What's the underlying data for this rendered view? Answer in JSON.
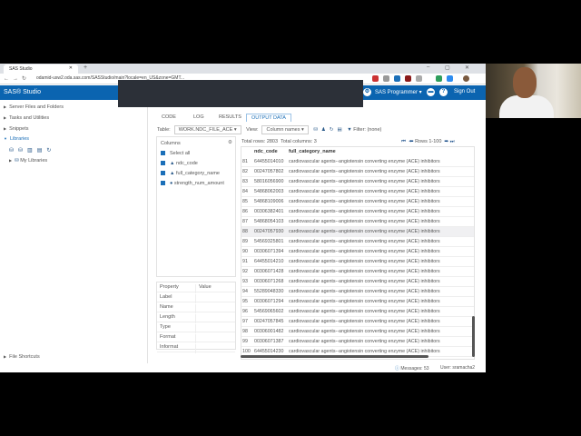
{
  "browser": {
    "tab_title": "SAS Studio",
    "url": "odamid-usw2.oda.sas.com/SASStudio/main?locale=en_US&zone=GMT..."
  },
  "header": {
    "app_name": "SAS® Studio",
    "menu": "SAS Programmer ▾",
    "sign_out": "Sign Out"
  },
  "sidebar": {
    "items": [
      "Server Files and Folders",
      "Tasks and Utilities",
      "Snippets",
      "Libraries"
    ],
    "my_libraries": "My Libraries",
    "file_shortcuts": "File Shortcuts"
  },
  "tabs": [
    "CODE",
    "LOG",
    "RESULTS",
    "OUTPUT DATA"
  ],
  "toolbar": {
    "table_label": "Table:",
    "table_value": "WORK.NDC_FILE_ACE",
    "view_label": "View:",
    "view_value": "Column names",
    "filter_label": "Filter:",
    "filter_value": "(none)"
  },
  "columns": {
    "title": "Columns",
    "select_all": "Select all",
    "items": [
      "ndc_code",
      "full_category_name",
      "strength_num_amount"
    ]
  },
  "properties": {
    "header": [
      "Property",
      "Value"
    ],
    "rows": [
      "Label",
      "Name",
      "Length",
      "Type",
      "Format",
      "Informat"
    ]
  },
  "grid": {
    "total_rows": "Total rows: 2803",
    "total_columns": "Total columns: 3",
    "pager": "Rows 1-100",
    "headers": [
      "ndc_code",
      "full_category_name"
    ],
    "category": "cardiovascular agents--angiotensin converting enzyme (ACE) inhibitors",
    "rows": [
      [
        "81",
        "64455014010"
      ],
      [
        "82",
        "00247057802"
      ],
      [
        "83",
        "58016056900"
      ],
      [
        "84",
        "54868062003"
      ],
      [
        "85",
        "54868109006"
      ],
      [
        "86",
        "00306382401"
      ],
      [
        "87",
        "54868054103"
      ],
      [
        "88",
        "00247057930"
      ],
      [
        "89",
        "54569325801"
      ],
      [
        "90",
        "00306071394"
      ],
      [
        "91",
        "64455014210"
      ],
      [
        "92",
        "00306071428"
      ],
      [
        "93",
        "00306071268"
      ],
      [
        "94",
        "55289048330"
      ],
      [
        "95",
        "00306071294"
      ],
      [
        "96",
        "54569065602"
      ],
      [
        "97",
        "00247057845"
      ],
      [
        "98",
        "00306001482"
      ],
      [
        "99",
        "00306071387"
      ],
      [
        "100",
        "64455014230"
      ]
    ]
  },
  "status": {
    "messages": "Messages: 53",
    "user": "User: sramacha2"
  }
}
